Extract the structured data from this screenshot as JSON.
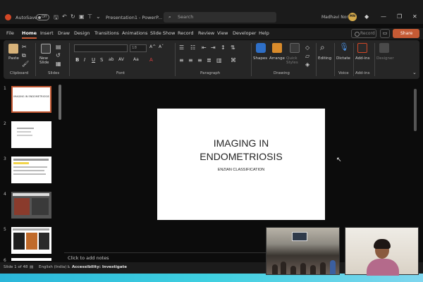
{
  "titlebar": {
    "autosave_label": "AutoSave",
    "autosave_state": "Off",
    "doc_title": "Presentation1 - PowerP...",
    "search_placeholder": "Search",
    "user_name": "Madhavi Nori",
    "user_initials": "MN"
  },
  "menu": {
    "tabs": [
      "File",
      "Home",
      "Insert",
      "Draw",
      "Design",
      "Transitions",
      "Animations",
      "Slide Show",
      "Record",
      "Review",
      "View",
      "Developer",
      "Help"
    ],
    "active_tab": "Home",
    "record_label": "Record",
    "share_label": "Share"
  },
  "ribbon": {
    "paste_label": "Paste",
    "new_slide_label": "New Slide",
    "groups": [
      "Clipboard",
      "Slides",
      "Font",
      "Paragraph",
      "Drawing",
      "Voice",
      "Add-ins"
    ],
    "font_size": "18",
    "shapes_label": "Shapes",
    "arrange_label": "Arrange",
    "quick_styles_label": "Quick Styles",
    "editing_label": "Editing",
    "dictate_label": "Dictate",
    "addins_label": "Add-ins",
    "designer_label": "Designer"
  },
  "slides": {
    "numbers": [
      "1",
      "2",
      "3",
      "4",
      "5",
      "6"
    ],
    "thumb1_title": "IMAGING IN ENDOMETRIOSIS",
    "active_index": 1
  },
  "slide": {
    "title_line1": "IMAGING IN",
    "title_line2": "ENDOMETRIOSIS",
    "subtitle": "ENZIAN CLASSIFICATION"
  },
  "notes": {
    "placeholder": "Click to add notes"
  },
  "status": {
    "slide_info": "Slide 1 of 48",
    "language": "English (India)",
    "accessibility": "Accessibility: Investigate"
  }
}
